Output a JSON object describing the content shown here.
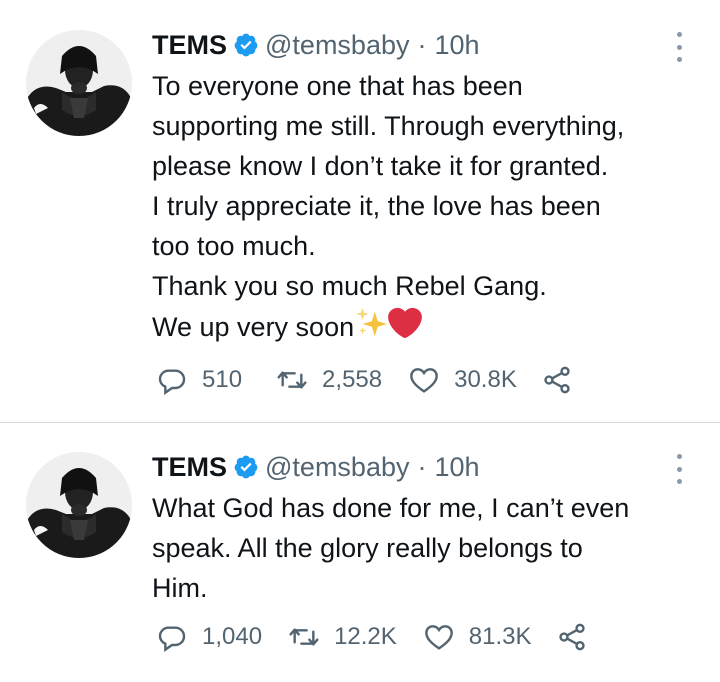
{
  "tweets": [
    {
      "name": "TEMS",
      "handle": "@temsbaby",
      "separator": "·",
      "time": "10h",
      "text": "To everyone one that has been\nsupporting me still. Through everything,\nplease know I don’t take it for granted.\nI truly appreciate it, the love has been\ntoo too much.\nThank you so much Rebel Gang.\nWe up very soon",
      "emojis": [
        "sparkles-icon",
        "red-heart-icon"
      ],
      "reply_count": "510",
      "retweet_count": "2,558",
      "like_count": "30.8K"
    },
    {
      "name": "TEMS",
      "handle": "@temsbaby",
      "separator": "·",
      "time": "10h",
      "text": "What God has done for me, I can’t even\nspeak. All the glory really belongs to\nHim.",
      "reply_count": "1,040",
      "retweet_count": "12.2K",
      "like_count": "81.3K"
    }
  ],
  "colors": {
    "text": "#0f1419",
    "secondary": "#536471",
    "verified": "#1d9bf0",
    "divider": "#d9d9d9",
    "heart_emoji": "#dd2e44",
    "sparkles_emoji": "#f4c23c"
  }
}
